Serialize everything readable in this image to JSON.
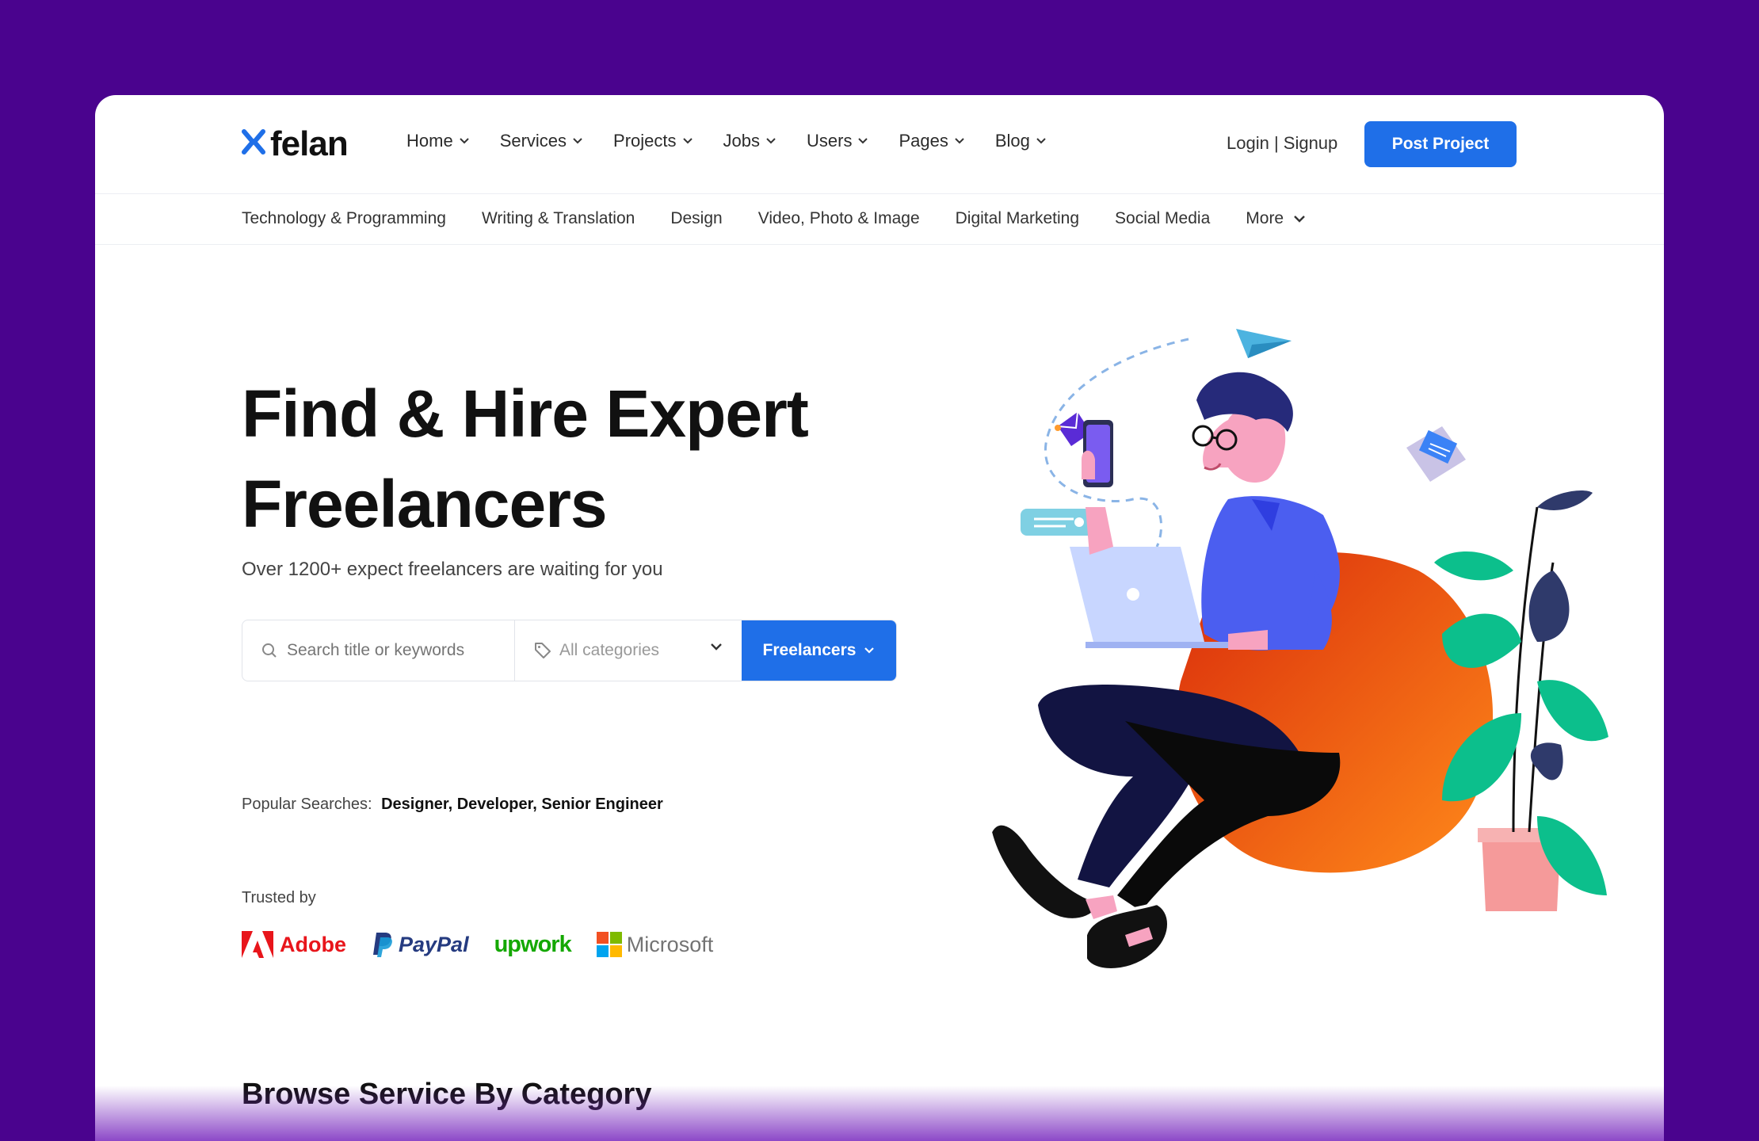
{
  "header": {
    "logo_text": "felan",
    "nav": [
      "Home",
      "Services",
      "Projects",
      "Jobs",
      "Users",
      "Pages",
      "Blog"
    ],
    "login": "Login | Signup",
    "post_project": "Post Project"
  },
  "categories": [
    "Technology & Programming",
    "Writing & Translation",
    "Design",
    "Video, Photo & Image",
    "Digital Marketing",
    "Social Media"
  ],
  "more_label": "More",
  "hero": {
    "title_line1": "Find & Hire Expert",
    "title_line2": "Freelancers",
    "subtitle": "Over 1200+ expect freelancers are waiting for you"
  },
  "search": {
    "placeholder": "Search title or keywords",
    "category": "All categories",
    "button": "Freelancers"
  },
  "popular": {
    "label": "Popular Searches:",
    "terms": "Designer, Developer, Senior Engineer"
  },
  "trusted": {
    "label": "Trusted by",
    "brands": [
      "Adobe",
      "PayPal",
      "upwork",
      "Microsoft"
    ]
  },
  "section_title": "Browse Service By Category",
  "colors": {
    "background": "#4a038e",
    "accent": "#1f6fe8"
  }
}
